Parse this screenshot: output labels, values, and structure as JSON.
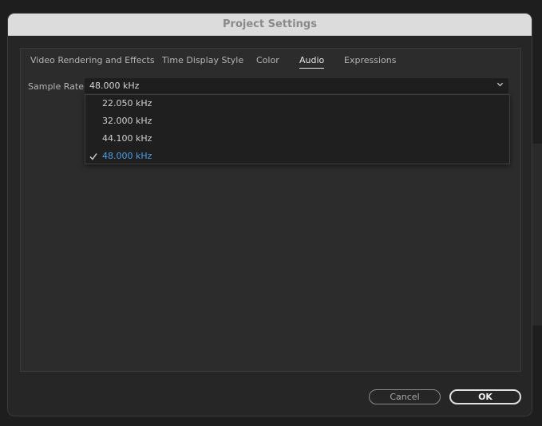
{
  "dialog": {
    "title": "Project Settings"
  },
  "tabs": [
    {
      "label": "Video Rendering and Effects",
      "active": false
    },
    {
      "label": "Time Display Style",
      "active": false
    },
    {
      "label": "Color",
      "active": false
    },
    {
      "label": "Audio",
      "active": true
    },
    {
      "label": "Expressions",
      "active": false
    }
  ],
  "audio": {
    "sample_rate_label": "Sample Rate:",
    "sample_rate_value": "48.000 kHz",
    "options": [
      "22.050 kHz",
      "32.000 kHz",
      "44.100 kHz",
      "48.000 kHz"
    ],
    "selected_index": 3
  },
  "buttons": {
    "cancel": "Cancel",
    "ok": "OK"
  },
  "colors": {
    "selected_option": "#4a9fe8",
    "title_bar": "#dcdcdc"
  },
  "icons": {
    "dropdown": "chevron-down-icon",
    "selected": "checkmark-icon"
  }
}
